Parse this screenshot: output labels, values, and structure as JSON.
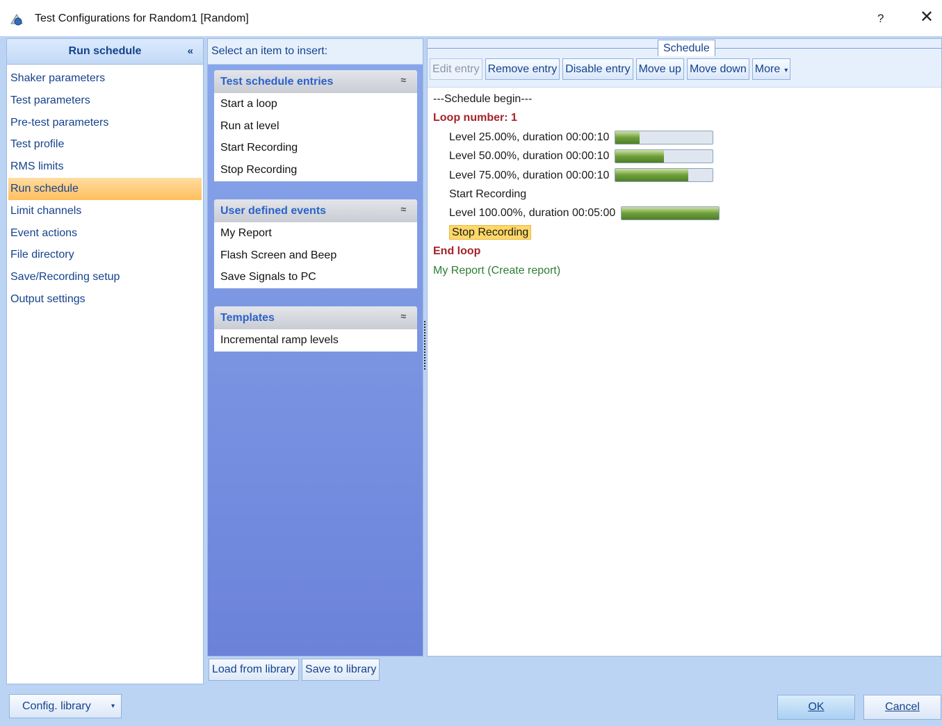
{
  "window": {
    "title": "Test Configurations for Random1 [Random]",
    "help": "?",
    "close": "✕"
  },
  "nav": {
    "header": "Run schedule",
    "collapse": "«",
    "items": [
      {
        "label": "Shaker parameters"
      },
      {
        "label": "Test parameters"
      },
      {
        "label": "Pre-test parameters"
      },
      {
        "label": "Test profile"
      },
      {
        "label": "RMS limits"
      },
      {
        "label": "Run schedule",
        "selected": true
      },
      {
        "label": "Limit channels"
      },
      {
        "label": "Event actions"
      },
      {
        "label": "File directory"
      },
      {
        "label": "Save/Recording setup"
      },
      {
        "label": "Output settings"
      }
    ]
  },
  "insert_panel": {
    "header": "Select an item to insert:",
    "groups": [
      {
        "title": "Test schedule entries",
        "chevron": "≈",
        "items": [
          "Start a loop",
          "Run at level",
          "Start Recording",
          "Stop Recording"
        ]
      },
      {
        "title": "User defined events",
        "chevron": "≈",
        "items": [
          "My Report",
          "Flash Screen and Beep",
          "Save Signals to PC"
        ]
      },
      {
        "title": "Templates",
        "chevron": "≈",
        "items": [
          "Incremental ramp levels"
        ]
      }
    ],
    "load_label": "Load from library",
    "save_label": "Save to library"
  },
  "schedule": {
    "tab_label": "Schedule",
    "toolbar": {
      "edit": "Edit entry",
      "remove": "Remove entry",
      "disable": "Disable entry",
      "move_up": "Move up",
      "move_down": "Move down",
      "more": "More",
      "more_caret": "▾"
    },
    "begin": "---Schedule begin---",
    "loop_label": "Loop number: 1",
    "entries": [
      {
        "text": "Level 25.00%, duration 00:00:10",
        "progress": 0.25
      },
      {
        "text": "Level 50.00%, duration 00:00:10",
        "progress": 0.5
      },
      {
        "text": "Level 75.00%, duration 00:00:10",
        "progress": 0.75
      },
      {
        "text": "Start Recording"
      },
      {
        "text": "Level 100.00%, duration 00:05:00",
        "progress": 1.0
      },
      {
        "text": "Stop Recording",
        "highlighted": true
      }
    ],
    "end_loop": "End loop",
    "report": "My Report (Create report)"
  },
  "footer": {
    "config_library": "Config. library",
    "config_caret": "▾",
    "ok": "OK",
    "cancel": "Cancel"
  },
  "colors": {
    "accent": "#15428b",
    "selected": "#ffbf5e",
    "loop": "#a5232a",
    "report": "#2e7d32",
    "panel": "#6b82da"
  }
}
